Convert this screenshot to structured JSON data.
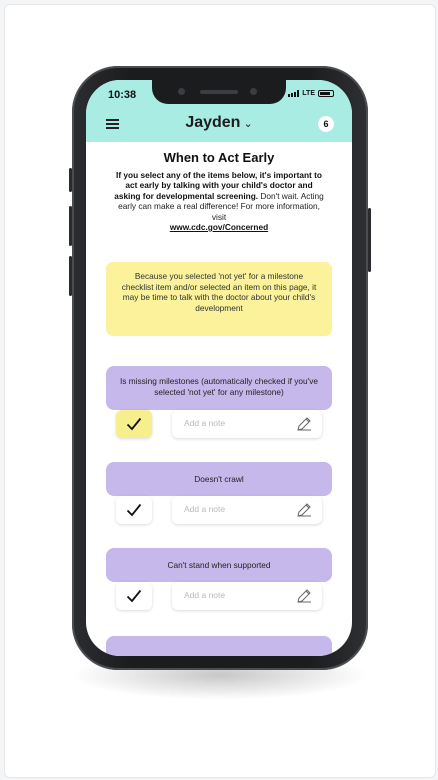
{
  "status": {
    "time": "10:38",
    "network": "LTE"
  },
  "header": {
    "child_name": "Jayden",
    "badge": "6"
  },
  "page": {
    "title": "When to Act Early",
    "intro_bold": "If you select any of the items below, it's important to act early by talking with your child's doctor and asking for developmental screening.",
    "intro_rest": " Don't wait. Acting early can make a real difference! For more information, visit",
    "link": "www.cdc.gov/Concerned"
  },
  "alert": {
    "text": "Because you selected 'not yet' for a milestone checklist item and/or selected an item on this page, it may be time to talk with the doctor about your child's development"
  },
  "items": [
    {
      "label": "Is missing milestones (automatically checked if you've selected 'not yet' for any milestone)",
      "checked": true,
      "note_placeholder": "Add a note"
    },
    {
      "label": "Doesn't crawl",
      "checked": false,
      "note_placeholder": "Add a note"
    },
    {
      "label": "Can't stand when supported",
      "checked": false,
      "note_placeholder": "Add a note"
    }
  ],
  "colors": {
    "header": "#a8ece4",
    "alert": "#fbf29b",
    "item_card": "#c7b8ec",
    "checked_box": "#f7ef8e"
  },
  "icons": [
    "menu-icon",
    "chevron-down-icon",
    "checkmark-icon",
    "pencil-icon",
    "signal-icon",
    "battery-icon"
  ]
}
